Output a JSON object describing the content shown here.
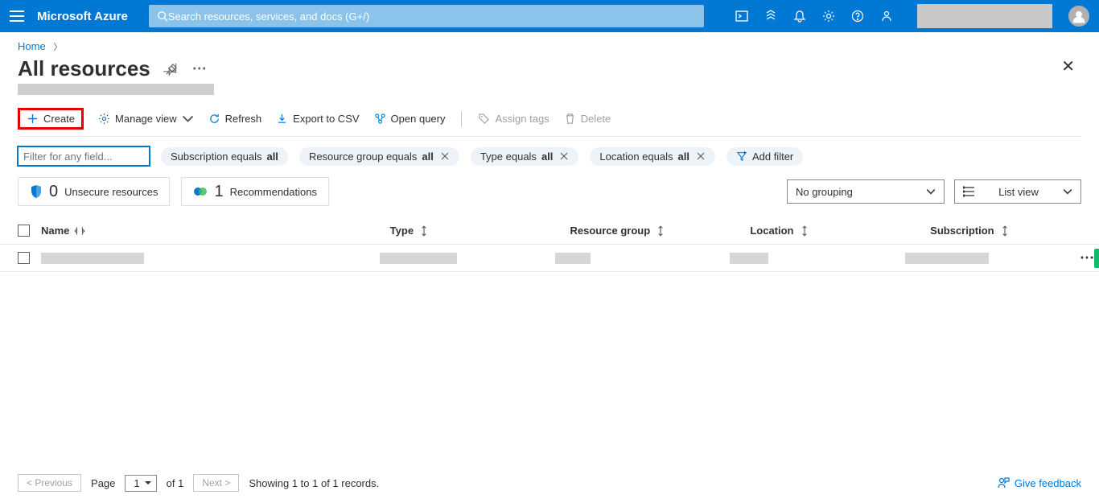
{
  "header": {
    "brand": "Microsoft Azure",
    "search_placeholder": "Search resources, services, and docs (G+/)"
  },
  "breadcrumb": {
    "home": "Home"
  },
  "page": {
    "title": "All resources"
  },
  "toolbar": {
    "create": "Create",
    "manage_view": "Manage view",
    "refresh": "Refresh",
    "export_csv": "Export to CSV",
    "open_query": "Open query",
    "assign_tags": "Assign tags",
    "delete": "Delete"
  },
  "filters": {
    "input_placeholder": "Filter for any field...",
    "subscription": "Subscription equals ",
    "subscription_val": "all",
    "rg": "Resource group equals ",
    "rg_val": "all",
    "type": "Type equals ",
    "type_val": "all",
    "location": "Location equals ",
    "location_val": "all",
    "add": "Add filter"
  },
  "cards": {
    "unsecure_count": "0",
    "unsecure_label": "Unsecure resources",
    "rec_count": "1",
    "rec_label": "Recommendations"
  },
  "selects": {
    "grouping": "No grouping",
    "view": "List view"
  },
  "columns": {
    "name": "Name",
    "type": "Type",
    "rg": "Resource group",
    "loc": "Location",
    "sub": "Subscription"
  },
  "pagination": {
    "prev": "< Previous",
    "next": "Next >",
    "page_label": "Page",
    "page_value": "1",
    "of": "of 1",
    "summary": "Showing 1 to 1 of 1 records."
  },
  "feedback": "Give feedback"
}
